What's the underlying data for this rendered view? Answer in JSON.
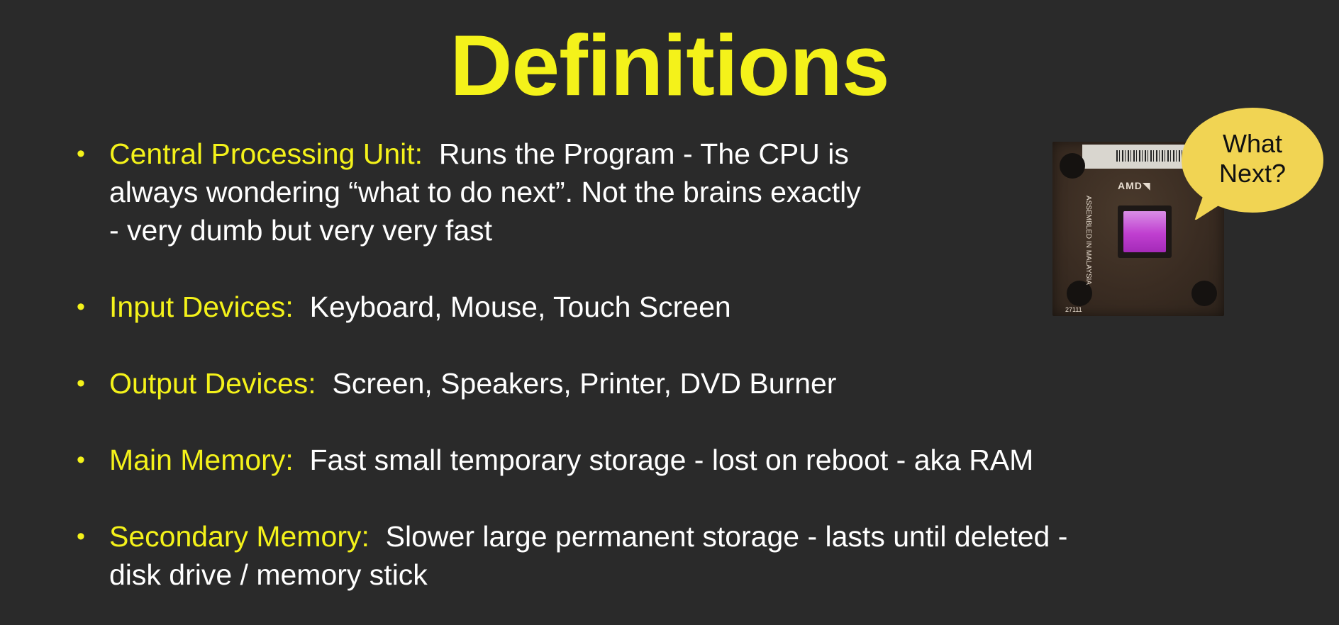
{
  "slide": {
    "title": "Definitions",
    "bullets": [
      {
        "term": "Central Processing Unit:",
        "lines": [
          "Runs the Program - The CPU is",
          "always wondering “what to do next”.  Not the brains exactly",
          "- very dumb but very very fast"
        ]
      },
      {
        "term": "Input Devices:",
        "lines": [
          "Keyboard, Mouse, Touch Screen"
        ]
      },
      {
        "term": "Output Devices:",
        "lines": [
          "Screen, Speakers, Printer, DVD Burner"
        ]
      },
      {
        "term": "Main Memory:",
        "lines": [
          "Fast small temporary storage - lost on reboot - aka RAM"
        ]
      },
      {
        "term": "Secondary Memory:",
        "lines": [
          "Slower large permanent storage - lasts until deleted -",
          "disk drive / memory stick"
        ]
      }
    ],
    "bullet_symbol": "•",
    "bubble": {
      "line1": "What",
      "line2": "Next?"
    },
    "cpu_image": {
      "logo": "AMD◥",
      "vertical_text": "ASSEMBLED IN MALAYSIA",
      "serial": "27111"
    },
    "colors": {
      "background": "#2a2a2a",
      "accent": "#f4f21a",
      "text": "#ffffff",
      "bubble": "#f1d453"
    }
  }
}
